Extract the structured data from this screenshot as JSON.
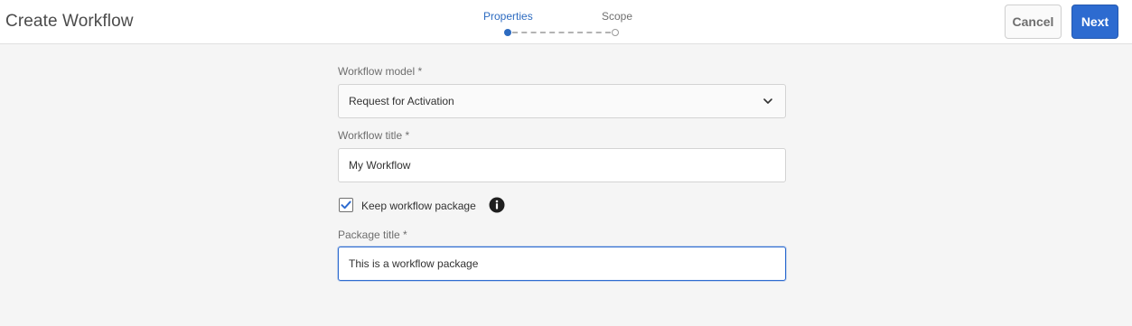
{
  "header": {
    "title": "Create Workflow",
    "cancel_label": "Cancel",
    "next_label": "Next"
  },
  "stepper": {
    "steps": [
      {
        "label": "Properties",
        "state": "active"
      },
      {
        "label": "Scope",
        "state": "pending"
      }
    ]
  },
  "form": {
    "model": {
      "label": "Workflow model *",
      "value": "Request for Activation",
      "icon": "chevron-down-icon"
    },
    "title": {
      "label": "Workflow title *",
      "value": "My Workflow"
    },
    "keep_package": {
      "label": "Keep workflow package",
      "checked": true,
      "icon": "info-icon"
    },
    "package_title": {
      "label": "Package title *",
      "value": "This is a workflow package"
    }
  },
  "colors": {
    "accent": "#2d6bd0",
    "background": "#f5f5f5",
    "header_bg": "#ffffff"
  }
}
